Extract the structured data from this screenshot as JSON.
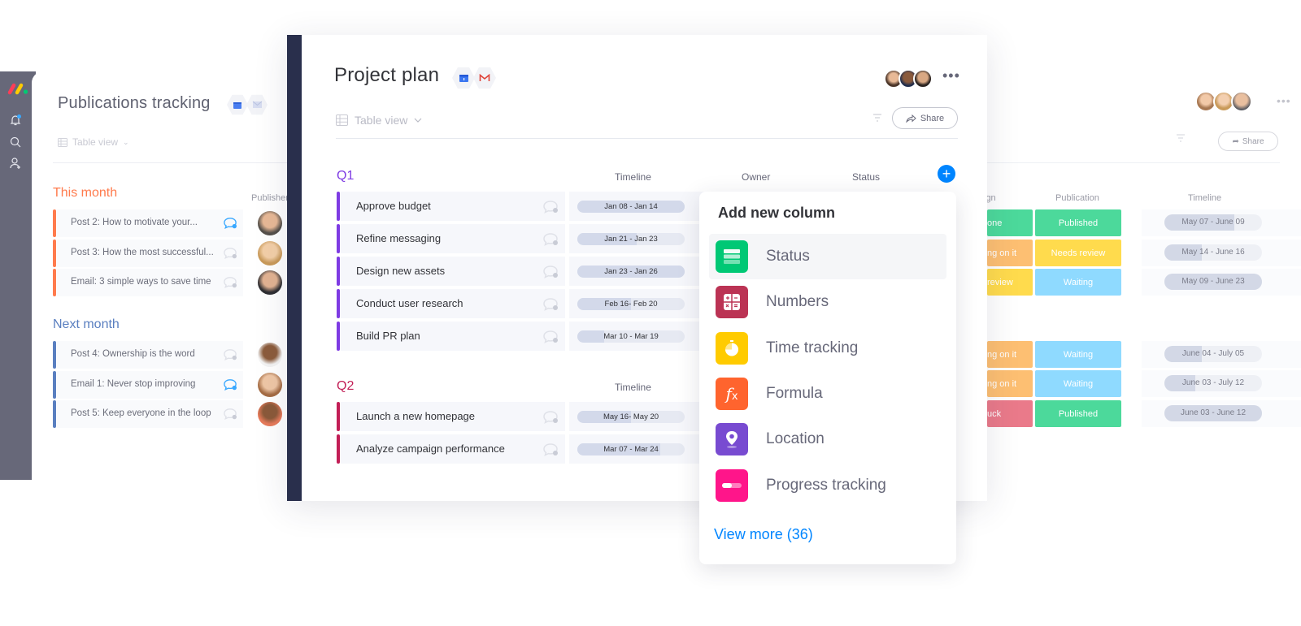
{
  "app": {
    "brand": "monday.com",
    "brand_colors": [
      "#ff3d57",
      "#ffcb00",
      "#00ca72"
    ]
  },
  "left_board": {
    "rail_icons": [
      "bell-icon",
      "search-icon",
      "add-user-icon"
    ],
    "title": "Publications tracking",
    "view_label": "Table view",
    "column_header": "Publisher",
    "groups": [
      {
        "title": "This month",
        "color": "#ff7b4d",
        "rows": [
          {
            "name": "Post 2: How to motivate your...",
            "has_update": true
          },
          {
            "name": "Post 3: How the most successful...",
            "has_update": false
          },
          {
            "name": "Email: 3 simple ways to save time",
            "has_update": false
          }
        ]
      },
      {
        "title": "Next month",
        "color": "#5a7fc0",
        "rows": [
          {
            "name": "Post 4: Ownership is the word",
            "has_update": false
          },
          {
            "name": "Email 1: Never stop improving",
            "has_update": true
          },
          {
            "name": "Post 5: Keep everyone in the loop",
            "has_update": false
          }
        ]
      }
    ]
  },
  "main_board": {
    "title": "Project plan",
    "view_label": "Table view",
    "share_label": "Share",
    "more_label": "•••",
    "groups": [
      {
        "title": "Q1",
        "color": "#7e3be3",
        "columns": [
          "Timeline",
          "Owner",
          "Status"
        ],
        "rows": [
          {
            "name": "Approve budget",
            "timeline": "Jan 08 - Jan 14",
            "progress": 1.0
          },
          {
            "name": "Refine messaging",
            "timeline": "Jan 21 - Jan 23",
            "progress": 0.55
          },
          {
            "name": "Design new assets",
            "timeline": "Jan 23 - Jan 26",
            "progress": 1.0
          },
          {
            "name": "Conduct user research",
            "timeline": "Feb 16- Feb 20",
            "progress": 0.5
          },
          {
            "name": "Build PR plan",
            "timeline": "Mar 10 - Mar 19",
            "progress": 0.25
          }
        ]
      },
      {
        "title": "Q2",
        "color": "#c21e56",
        "columns": [
          "Timeline"
        ],
        "rows": [
          {
            "name": "Launch a new homepage",
            "timeline": "May 16- May 20",
            "progress": 0.5
          },
          {
            "name": "Analyze campaign performance",
            "timeline": "Mar 07 - Mar 24",
            "progress": 0.77
          }
        ]
      }
    ]
  },
  "add_column_menu": {
    "title": "Add new column",
    "items": [
      {
        "label": "Status",
        "icon": "status-icon",
        "color": "#00c875"
      },
      {
        "label": "Numbers",
        "icon": "numbers-icon",
        "color": "#bb3354"
      },
      {
        "label": "Time tracking",
        "icon": "time-tracking-icon",
        "color": "#ffcb00"
      },
      {
        "label": "Formula",
        "icon": "formula-icon",
        "color": "#ff642e"
      },
      {
        "label": "Location",
        "icon": "location-icon",
        "color": "#784bd1"
      },
      {
        "label": "Progress tracking",
        "icon": "progress-icon",
        "color": "#ff158a"
      }
    ],
    "view_more": "View more (36)"
  },
  "right_board": {
    "share_label": "Share",
    "more_label": "•••",
    "columns": [
      "ign",
      "Publication",
      "Timeline"
    ],
    "rows": [
      {
        "design": "one",
        "design_color": "#4cd99b",
        "publication": "Published",
        "pub_color": "#4cd99b",
        "timeline": "May 07 - June 09",
        "progress": 0.72
      },
      {
        "design": "ng on it",
        "design_color": "#fdbf72",
        "publication": "Needs review",
        "pub_color": "#ffdb4d",
        "timeline": "May 14 - June 16",
        "progress": 0.38
      },
      {
        "design": " review",
        "design_color": "#ffdb4d",
        "publication": "Waiting",
        "pub_color": "#8fdaff",
        "timeline": "May 09 - June 23",
        "progress": 1.0
      },
      {
        "design": "ng on it",
        "design_color": "#fdbf72",
        "publication": "Waiting",
        "pub_color": "#8fdaff",
        "timeline": "June 04 - July 05",
        "progress": 0.38
      },
      {
        "design": "ng on it",
        "design_color": "#fdbf72",
        "publication": "Waiting",
        "pub_color": "#8fdaff",
        "timeline": "June 03 - July 12",
        "progress": 0.32
      },
      {
        "design": "uck",
        "design_color": "#ea7a8a",
        "publication": "Published",
        "pub_color": "#4cd99b",
        "timeline": "June 03 - June 12",
        "progress": 1.0
      }
    ]
  }
}
